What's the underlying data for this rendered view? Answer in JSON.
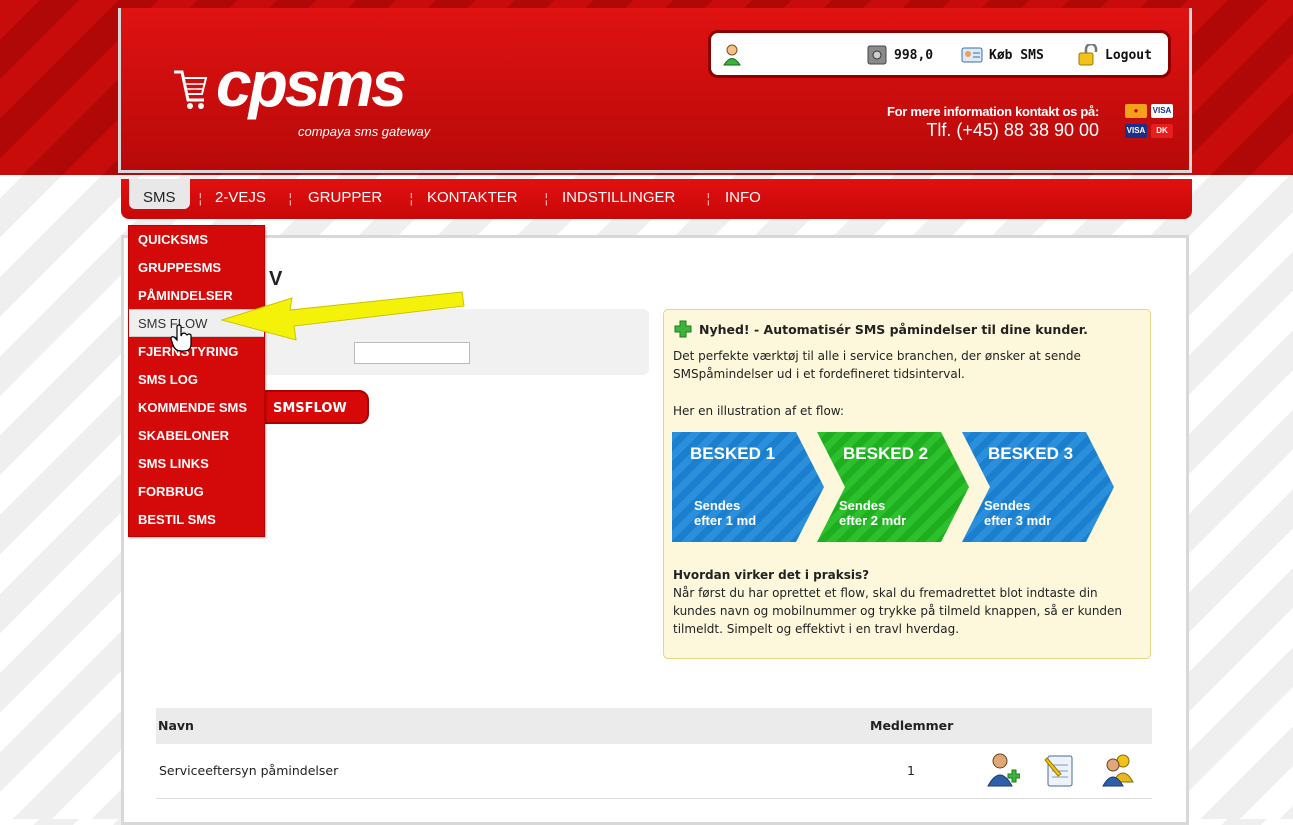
{
  "brand": {
    "logo_text": "cpsms",
    "tagline": "compaya sms gateway"
  },
  "userbar": {
    "credits": "998,0",
    "buy_label": "Køb SMS",
    "logout_label": "Logout"
  },
  "contact": {
    "line1": "For mere information kontakt os på:",
    "line2": "Tlf. (+45) 88 38 90 00"
  },
  "nav": {
    "items": [
      "SMS",
      "2-VEJS",
      "GRUPPER",
      "KONTAKTER",
      "INDSTILLINGER",
      "INFO"
    ]
  },
  "dropdown": {
    "items": [
      "QUICKSMS",
      "GRUPPESMS",
      "PÅMINDELSER",
      "SMS FLOW",
      "FJERNSTYRING",
      "SMS LOG",
      "KOMMENDE SMS",
      "SKABELONER",
      "SMS LINKS",
      "FORBRUG",
      "BESTIL SMS"
    ],
    "hovered": "SMS FLOW"
  },
  "main": {
    "title_visible": "V",
    "button_label": "SMSFLOW"
  },
  "info": {
    "heading": "Nyhed! - Automatisér SMS påmindelser til dine kunder.",
    "para1": "Det perfekte værktøj til alle i service branchen, der ønsker at sende SMSpåmindelser ud i et fordefineret tidsinterval.",
    "para2": "Her en illustration af et flow:",
    "flow": [
      {
        "title": "BESKED 1",
        "line1": "Sendes",
        "line2": "efter 1 md",
        "color": "#1b7fcf"
      },
      {
        "title": "BESKED 2",
        "line1": "Sendes",
        "line2": "efter 2 mdr",
        "color": "#1fae1f"
      },
      {
        "title": "BESKED 3",
        "line1": "Sendes",
        "line2": "efter 3 mdr",
        "color": "#1b7fcf"
      }
    ],
    "how_title": "Hvordan virker det i praksis?",
    "how_text": "Når først du har oprettet et flow, skal du fremadrettet blot indtaste din kundes navn og mobilnummer og trykke på tilmeld knappen, så er kunden tilmeldt. Simpelt og effektivt i en travl hverdag."
  },
  "table": {
    "headers": {
      "name": "Navn",
      "members": "Medlemmer"
    },
    "rows": [
      {
        "name": "Serviceeftersyn påmindelser",
        "members": "1"
      }
    ]
  },
  "colors": {
    "brand_red": "#d40909",
    "info_bg": "#fdf8dc",
    "arrow_yellow": "#f5f20a"
  }
}
